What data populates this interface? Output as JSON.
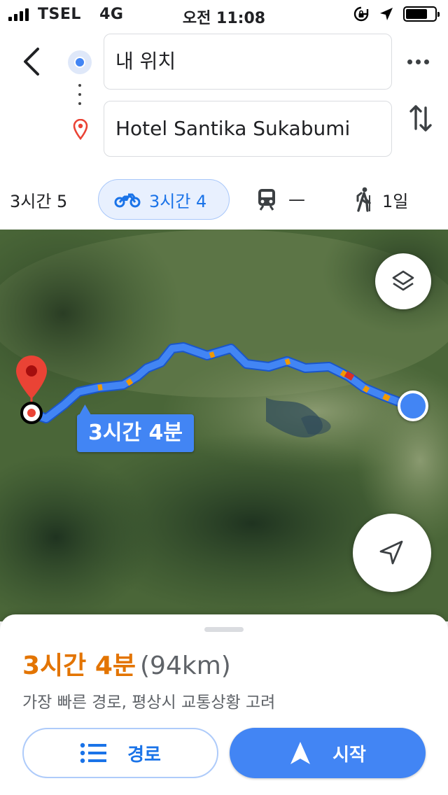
{
  "status_bar": {
    "carrier": "TSEL",
    "network": "4G",
    "time": "오전 11:08"
  },
  "directions": {
    "origin": "내 위치",
    "destination": "Hotel Santika Sukabumi"
  },
  "modes": {
    "car": "3시간 5",
    "motorcycle": "3시간 4",
    "transit": "—",
    "walk": "1일"
  },
  "map": {
    "route_label": "3시간 4분",
    "route_color": "#4285f4",
    "destination_pin_color": "#ea4335"
  },
  "route_summary": {
    "duration": "3시간 4분",
    "distance": "(94km)",
    "description": "가장 빠른 경로, 평상시 교통상황 고려"
  },
  "buttons": {
    "steps": "경로",
    "start": "시작"
  },
  "colors": {
    "accent": "#4285f4",
    "duration": "#e37400"
  }
}
